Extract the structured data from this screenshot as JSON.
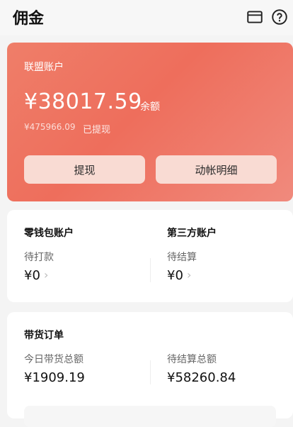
{
  "header": {
    "title": "佣金",
    "icons": [
      "card-icon",
      "help-icon"
    ]
  },
  "account": {
    "label": "联盟账户",
    "balance": "¥38017.59",
    "balance_label": "余额",
    "withdrawn": "¥475966.09",
    "withdrawn_label": "已提现",
    "withdraw_button": "提现",
    "detail_button": "动帐明细"
  },
  "wallet": {
    "left": {
      "title": "零钱包账户",
      "sub": "待打款",
      "value": "¥0",
      "chevron": "›"
    },
    "right": {
      "title": "第三方账户",
      "sub": "待结算",
      "value": "¥0",
      "chevron": "›"
    }
  },
  "orders": {
    "title": "带货订单",
    "left": {
      "sub": "今日带货总额",
      "value": "¥1909.19"
    },
    "right": {
      "sub": "待结算总额",
      "value": "¥58260.84"
    }
  },
  "colors": {
    "accent_start": "#ef7e69",
    "accent_end": "#f08a7d",
    "button_bg": "#f9dbd3"
  }
}
